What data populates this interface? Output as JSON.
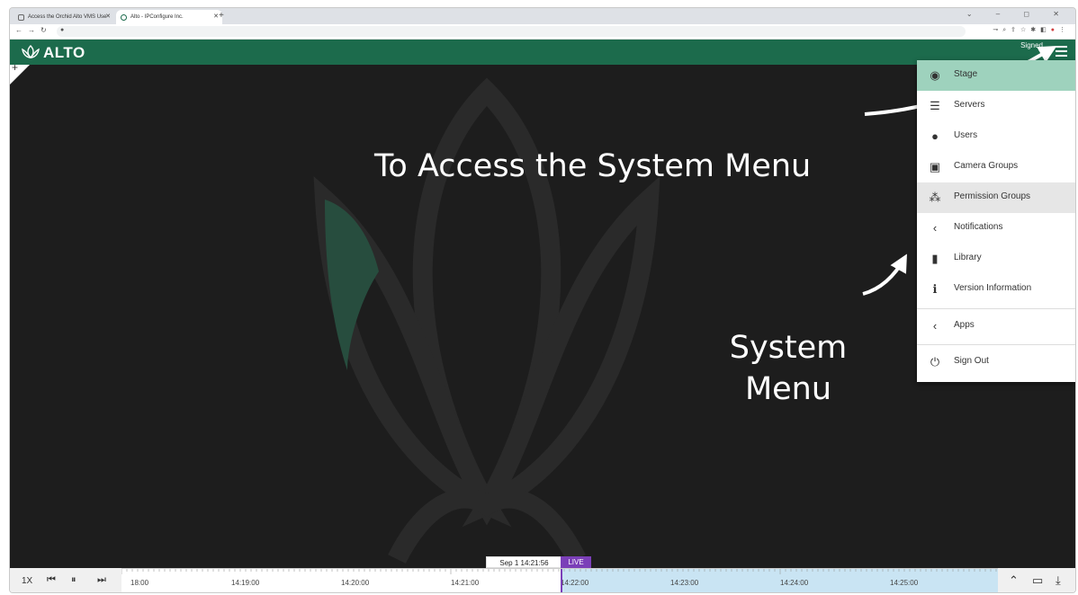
{
  "browser": {
    "tabs": [
      {
        "title": "Access the Orchid Alto VMS Use"
      },
      {
        "title": "Alto - IPConfigure Inc."
      }
    ],
    "new_tab": "+",
    "window_controls": "⌄ – ◻ ✕"
  },
  "app": {
    "logo_text": "ALTO",
    "signed_in": "Signed",
    "brand_color": "#1c6b4c"
  },
  "annotations": {
    "access": "To Access the System Menu",
    "system_line1": "System",
    "system_line2": "Menu"
  },
  "system_menu": {
    "items": [
      {
        "label": "Stage",
        "icon": "eye-icon",
        "state": "active"
      },
      {
        "label": "Servers",
        "icon": "server-icon"
      },
      {
        "label": "Users",
        "icon": "user-icon"
      },
      {
        "label": "Camera Groups",
        "icon": "camera-group-icon"
      },
      {
        "label": "Permission Groups",
        "icon": "group-icon",
        "state": "hover"
      },
      {
        "label": "Notifications",
        "icon": "chevron-left-icon"
      },
      {
        "label": "Library",
        "icon": "bookmark-icon"
      },
      {
        "label": "Version Information",
        "icon": "info-icon"
      },
      {
        "label": "Apps",
        "icon": "chevron-left-icon"
      },
      {
        "label": "Sign Out",
        "icon": "power-icon"
      }
    ]
  },
  "timeline": {
    "speed": "1X",
    "current_time": "Sep 1 14:21:56",
    "live_label": "LIVE",
    "tick_labels": [
      "18:00",
      "14:19:00",
      "14:20:00",
      "14:21:00",
      "14:22:00",
      "14:23:00",
      "14:24:00",
      "14:25:00"
    ],
    "live_color": "#7b3fb8"
  }
}
